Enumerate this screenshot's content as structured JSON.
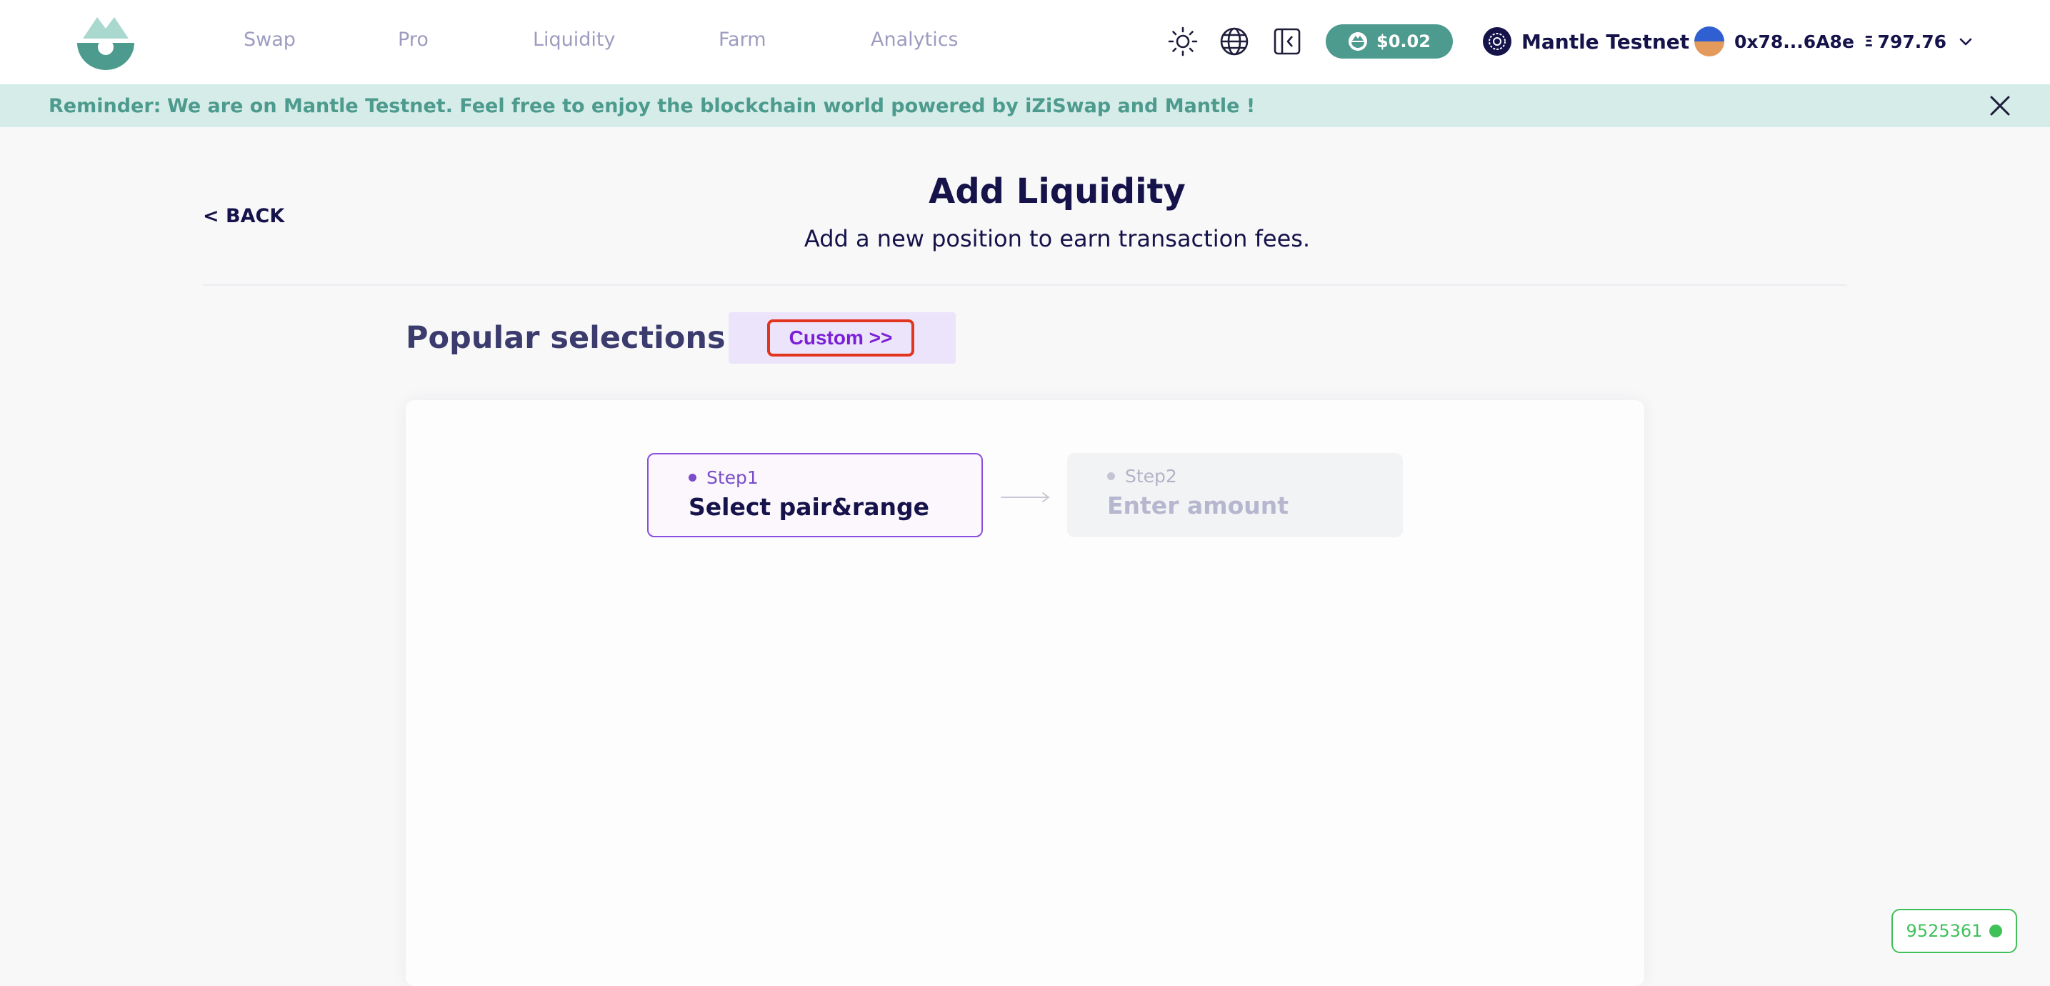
{
  "nav": {
    "items": [
      {
        "label": "Swap"
      },
      {
        "label": "Pro"
      },
      {
        "label": "Liquidity"
      },
      {
        "label": "Farm"
      },
      {
        "label": "Analytics"
      }
    ]
  },
  "header": {
    "icons": [
      "sun-icon",
      "globe-icon",
      "sidebar-collapse-icon"
    ],
    "price": "$0.02",
    "network": "Mantle Testnet",
    "account_address": "0x78...6A8e",
    "balance": "797.76",
    "balance_symbol": "Ξ"
  },
  "reminder": {
    "label": "Reminder:",
    "text": "We are on Mantle Testnet. Feel free to enjoy the blockchain world powered by iZiSwap and Mantle !"
  },
  "page": {
    "back_label": "< BACK",
    "title": "Add Liquidity",
    "subtitle": "Add a new position to earn transaction fees."
  },
  "selection": {
    "popular_label": "Popular selections",
    "custom_label": "Custom >>"
  },
  "steps": [
    {
      "label": "Step1",
      "title": "Select pair&range"
    },
    {
      "label": "Step2",
      "title": "Enter amount"
    }
  ],
  "block": {
    "number": "9525361"
  },
  "colors": {
    "accent": "#4d9b8e",
    "purple": "#7a1fd6",
    "highlight": "#e2351f",
    "status_green": "#3fc15a"
  }
}
